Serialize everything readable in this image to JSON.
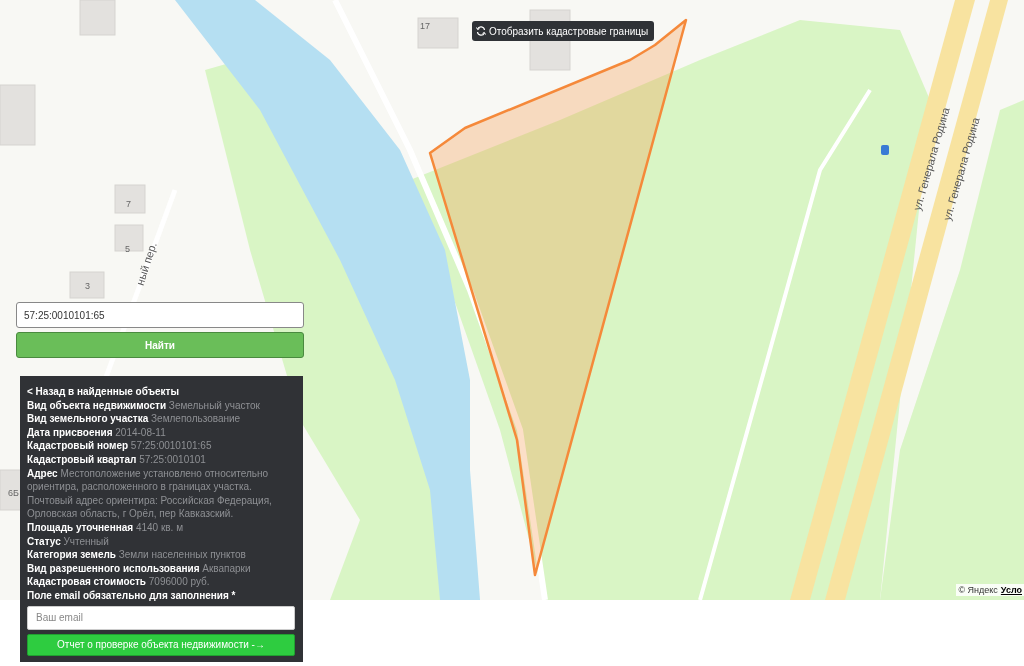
{
  "map": {
    "toggle_button": "Отобразить кадастровые границы",
    "house_numbers": [
      "17",
      "7",
      "5",
      "3",
      "6Б"
    ],
    "street_labels": [
      "ул. Генерала Родина",
      "ул. Генерала Родина",
      "ный пер."
    ],
    "attribution": "© Яндекс",
    "terms_link": "Усло"
  },
  "search": {
    "value": "57:25:0010101:65",
    "button": "Найти"
  },
  "details": {
    "back_link": "< Назад в найденные объекты",
    "fields": [
      {
        "label": "Вид объекта недвижимости",
        "value": "Земельный участок"
      },
      {
        "label": "Вид земельного участка",
        "value": "Землепользование"
      },
      {
        "label": "Дата присвоения",
        "value": "2014-08-11"
      },
      {
        "label": "Кадастровый номер",
        "value": "57:25:0010101:65"
      },
      {
        "label": "Кадастровый квартал",
        "value": "57:25:0010101"
      },
      {
        "label": "Адрес",
        "value": "Местоположение установлено относительно ориентира, расположенного в границах участка. Почтовый адрес ориентира: Российская Федерация, Орловская область, г Орёл, пер Кавказский."
      },
      {
        "label": "Площадь уточненная",
        "value": "4140 кв. м"
      },
      {
        "label": "Статус",
        "value": "Учтенный"
      },
      {
        "label": "Категория земель",
        "value": "Земли населенных пунктов"
      },
      {
        "label": "Вид разрешенного использования",
        "value": "Аквапарки"
      },
      {
        "label": "Кадастровая стоимость",
        "value": "7096000 руб."
      }
    ],
    "email_label": "Поле email обязательно для заполнения *",
    "email_placeholder": "Ваш email",
    "report_button": "Отчет о проверке объекта недвижимости -→"
  }
}
